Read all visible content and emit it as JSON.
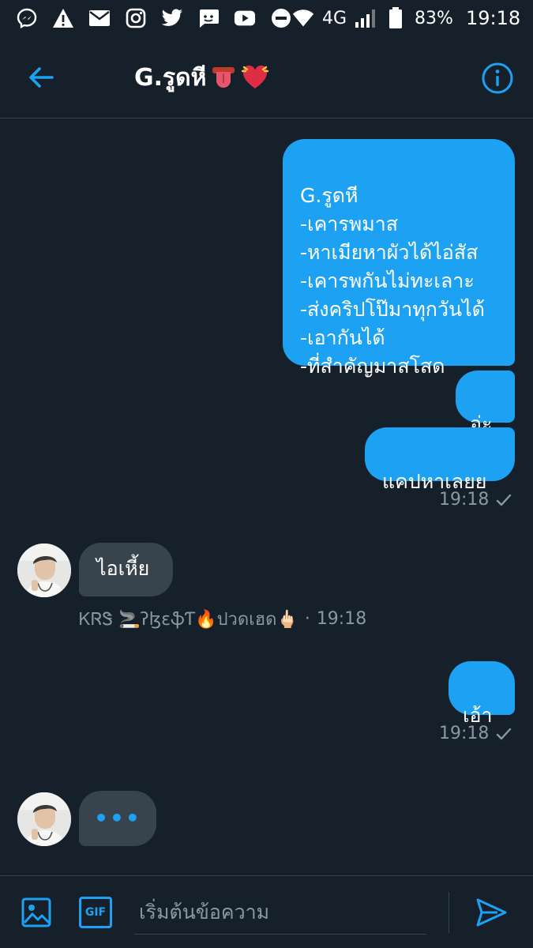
{
  "status_bar": {
    "network": "4G",
    "battery": "83%",
    "time": "19:18"
  },
  "header": {
    "title": "G.รูดหี"
  },
  "messages": {
    "m1": {
      "direction": "sent",
      "text": "G.รูดหี\n-เคารพมาส\n-หาเมียหาผัวได้ไอ่สัส\n-เคารพกันไม่ทะเลาะ\n-ส่งคริปโป๊มาทุกวันได้\n-เอากันได้\n-ที่สำคัญมาสโสด"
    },
    "m2": {
      "direction": "sent",
      "text": "อ่ะ"
    },
    "m3": {
      "direction": "sent",
      "text": "แคปหาเลยย"
    },
    "m3_meta": {
      "time": "19:18"
    },
    "m4": {
      "direction": "received",
      "text": "ไอเหี้ย"
    },
    "m4_meta": {
      "sender": "ᏦᏒᏕ 🚬ʔɮɛֆƬ🔥ปวดเฮด🖕🏻",
      "time": "19:18"
    },
    "m5": {
      "direction": "sent",
      "text": "เอ้า"
    },
    "m5_meta": {
      "time": "19:18"
    },
    "typing": {
      "label": "•••"
    }
  },
  "composer": {
    "placeholder": "เริ่มต้นข้อความ",
    "gif_label": "GIF"
  },
  "colors": {
    "background": "#15202b",
    "sent_bubble": "#1da1f2",
    "received_bubble": "#38444d",
    "accent": "#1da1f2",
    "muted_text": "#8899a6"
  }
}
